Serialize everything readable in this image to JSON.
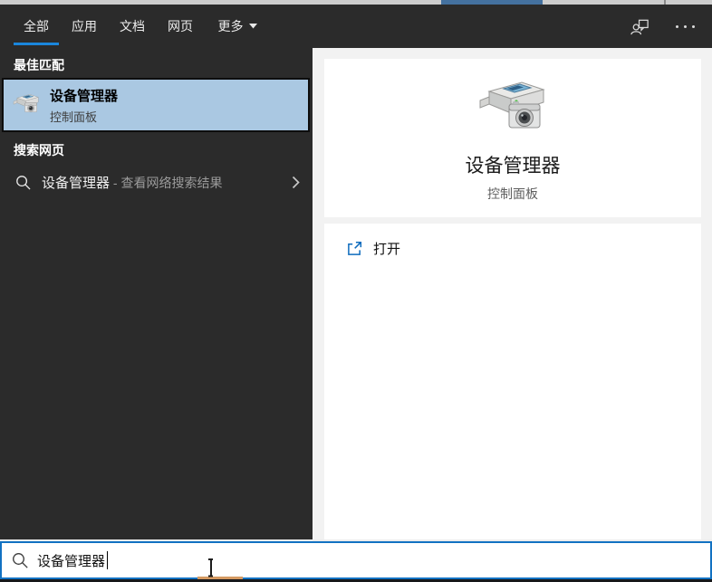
{
  "colors": {
    "accent": "#1a86dc",
    "topbar-bg": "#2b2b2b",
    "panel-bg": "#2b2b2b",
    "highlight": "#aac8e2",
    "highlight-border": "#0d0d0d",
    "right-bg": "#f2f2f2",
    "search-border": "#1272c2",
    "open-blue": "#0f6cbd",
    "strip-blue": "#44719f",
    "taskbar-orange": "#d59a62"
  },
  "tabs": {
    "items": [
      {
        "label": "全部"
      },
      {
        "label": "应用"
      },
      {
        "label": "文档"
      },
      {
        "label": "网页"
      },
      {
        "label": "更多"
      }
    ],
    "active_index": 0
  },
  "left_panel": {
    "best_match_header": "最佳匹配",
    "best_match": {
      "title": "设备管理器",
      "subtitle": "控制面板"
    },
    "web_search_header": "搜索网页",
    "web_search": {
      "query": "设备管理器",
      "suffix": " - 查看网络搜索结果"
    }
  },
  "preview": {
    "title": "设备管理器",
    "subtitle": "控制面板",
    "open_label": "打开"
  },
  "search_bar": {
    "value": "设备管理器"
  }
}
